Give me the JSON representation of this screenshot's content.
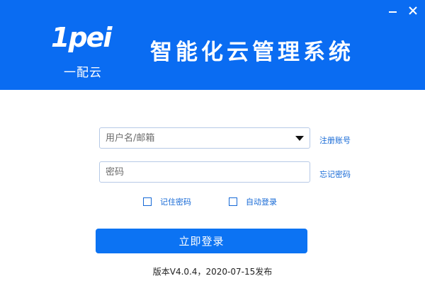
{
  "window": {
    "minimize_icon": "minimize-icon",
    "close_icon": "close-icon"
  },
  "brand": {
    "logo_mark": "1pei",
    "logo_text": "一配云",
    "system_title": "智能化云管理系统"
  },
  "form": {
    "username_placeholder": "用户名/邮箱",
    "password_placeholder": "密码",
    "register_link": "注册账号",
    "forgot_link": "忘记密码",
    "remember_label": "记住密码",
    "auto_login_label": "自动登录",
    "submit_label": "立即登录"
  },
  "footer": {
    "version": "版本V4.0.4，2020-07-15发布"
  },
  "colors": {
    "header_bg": "#0a6cf2",
    "button_bg": "#0c73f3",
    "link": "#1669d6"
  }
}
